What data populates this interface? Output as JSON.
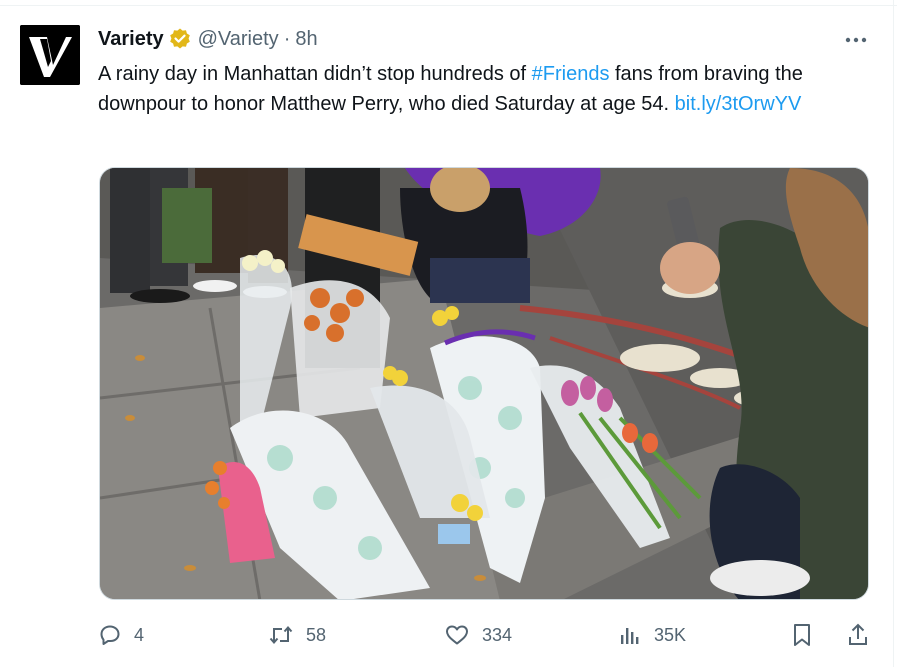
{
  "tweet": {
    "author": {
      "display_name": "Variety",
      "handle": "@Variety",
      "verified_badge": "gold-verified-icon",
      "avatar_icon": "variety-v-logo"
    },
    "separator": "·",
    "time_ago": "8h",
    "more_icon": "more-dots-icon",
    "text": {
      "part1": "A rainy day in Manhattan didn’t stop hundreds of ",
      "hashtag": "#Friends",
      "part2": " fans from braving the downpour to honor Matthew Perry, who died Saturday at age 54. ",
      "link": "bit.ly/3tOrwYV"
    },
    "media": {
      "description_icon": "photo-street-memorial-flowers"
    },
    "actions": {
      "reply_count": "4",
      "retweet_count": "58",
      "like_count": "334",
      "views_count": "35K"
    }
  },
  "colors": {
    "link_blue": "#1d9bf0",
    "secondary_text": "#536471",
    "verified_gold": "#e2b719",
    "purple_umbrella": "#6a2fb0"
  }
}
